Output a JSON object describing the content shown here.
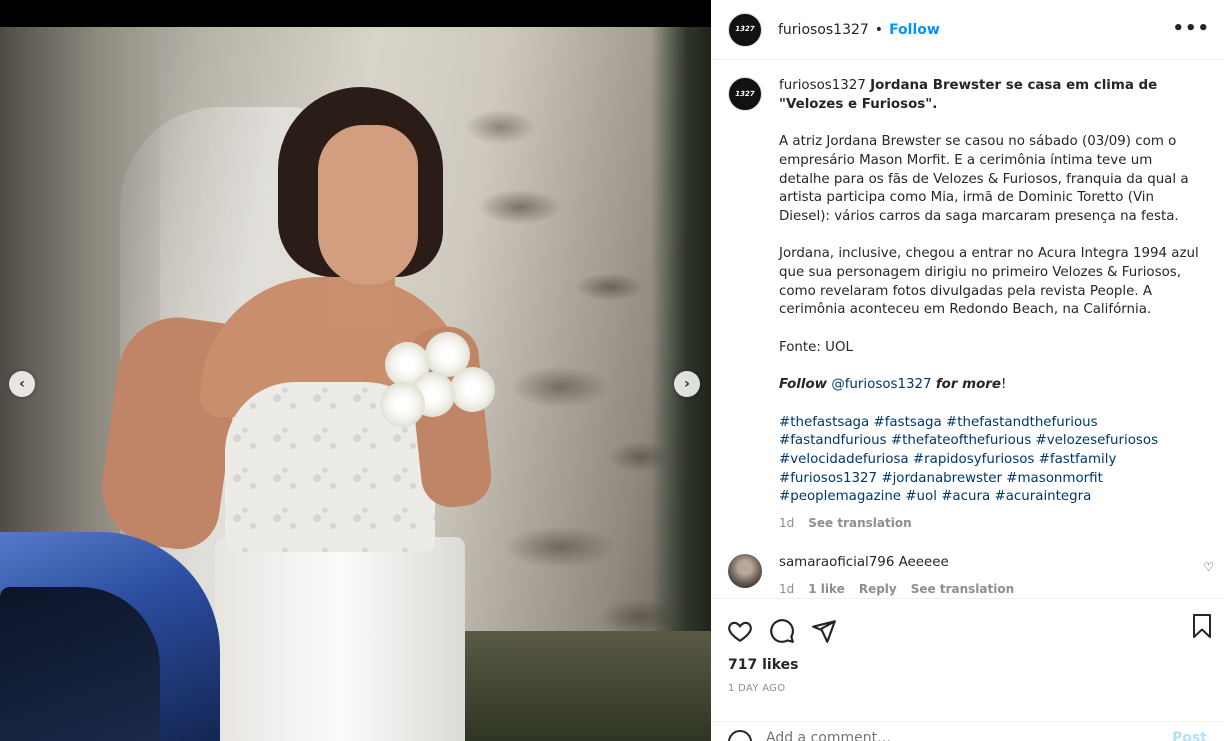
{
  "post": {
    "username": "furiosos1327",
    "follow_label": "Follow",
    "more_label": "•••",
    "avatar_text": "1327"
  },
  "caption": {
    "username": "furiosos1327",
    "title": "Jordana Brewster se casa em clima de \"Velozes e Furiosos\".",
    "paragraphs": [
      "A atriz Jordana Brewster se casou no sábado (03/09) com o empresário Mason Morfit. E a cerimônia íntima teve um detalhe para os fãs de Velozes & Furiosos, franquia da qual a artista participa como Mia, irmã de Dominic Toretto (Vin Diesel): vários carros da saga marcaram presença na festa.",
      "Jordana, inclusive, chegou a entrar no Acura Integra 1994 azul que sua personagem dirigiu no primeiro Velozes & Furiosos, como revelaram fotos divulgadas pela revista People. A cerimônia aconteceu em Redondo Beach, na Califórnia.",
      "Fonte: UOL"
    ],
    "follow_prefix": "Follow",
    "follow_mention": "@furiosos1327",
    "follow_suffix": "for more",
    "follow_end": "!",
    "hashtags": [
      "#thefastsaga",
      "#fastsaga",
      "#thefastandthefurious",
      "#fastandfurious",
      "#thefateofthefurious",
      "#velozesefuriosos",
      "#velocidadefuriosa",
      "#rapidosyfuriosos",
      "#fastfamily",
      "#furiosos1327",
      "#jordanabrewster",
      "#masonmorfit",
      "#peoplemagazine",
      "#uol",
      "#acura",
      "#acuraintegra"
    ],
    "time": "1d",
    "see_translation": "See translation"
  },
  "comment": {
    "username": "samaraoficial796",
    "text": "Aeeeee",
    "time": "1d",
    "likes": "1 like",
    "reply": "Reply",
    "see_translation": "See translation"
  },
  "engagement": {
    "likes": "717 likes",
    "time_ago": "1 DAY AGO"
  },
  "add_comment": {
    "placeholder": "Add a comment…",
    "post_label": "Post"
  },
  "nav": {
    "prev": "‹",
    "next": "›"
  },
  "colors": {
    "link": "#0095f6",
    "hashtag": "#00376b",
    "muted": "#8e8e8e"
  }
}
